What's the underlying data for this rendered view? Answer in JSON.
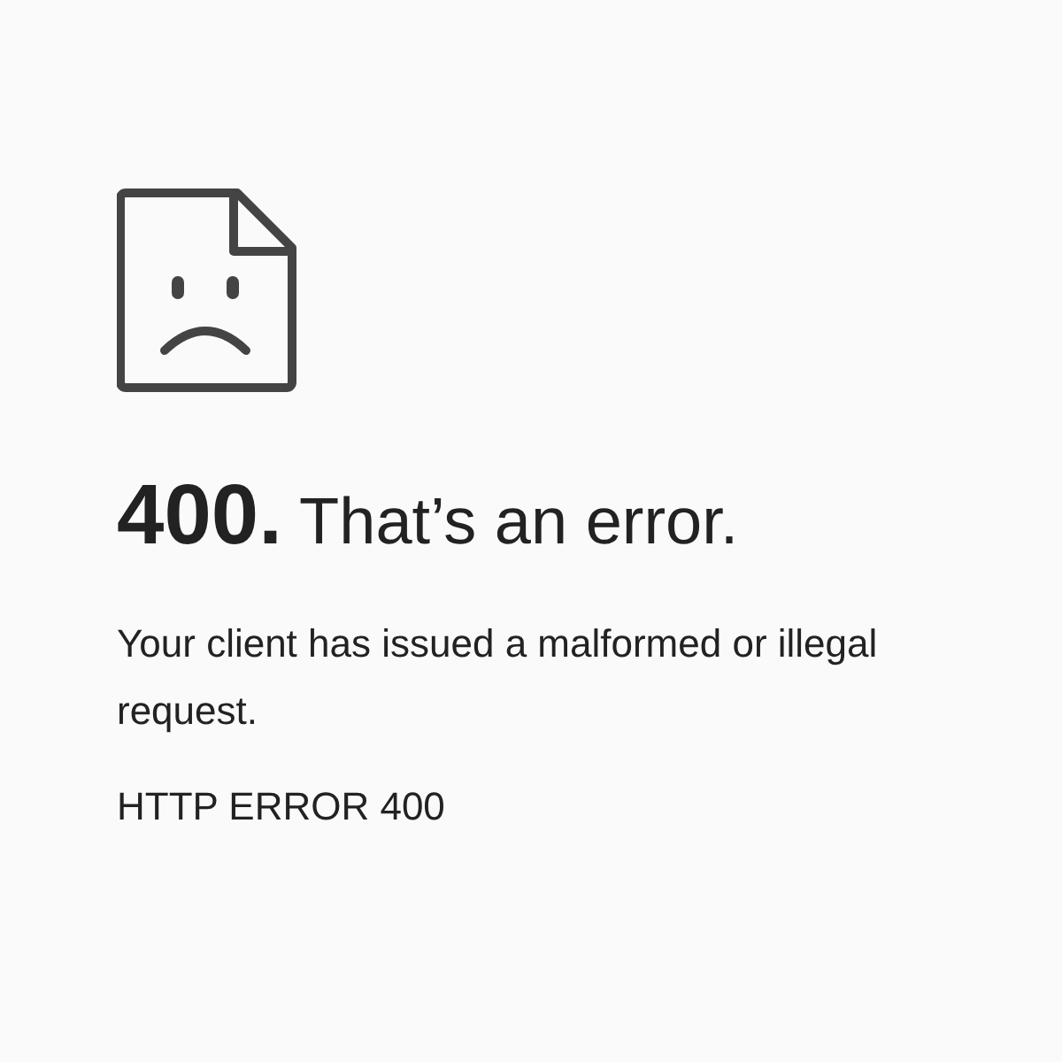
{
  "heading": "**400.** That’s an error.",
  "message": "Your client has issued a malformed or illegal request.",
  "error_code": "HTTP ERROR 400"
}
